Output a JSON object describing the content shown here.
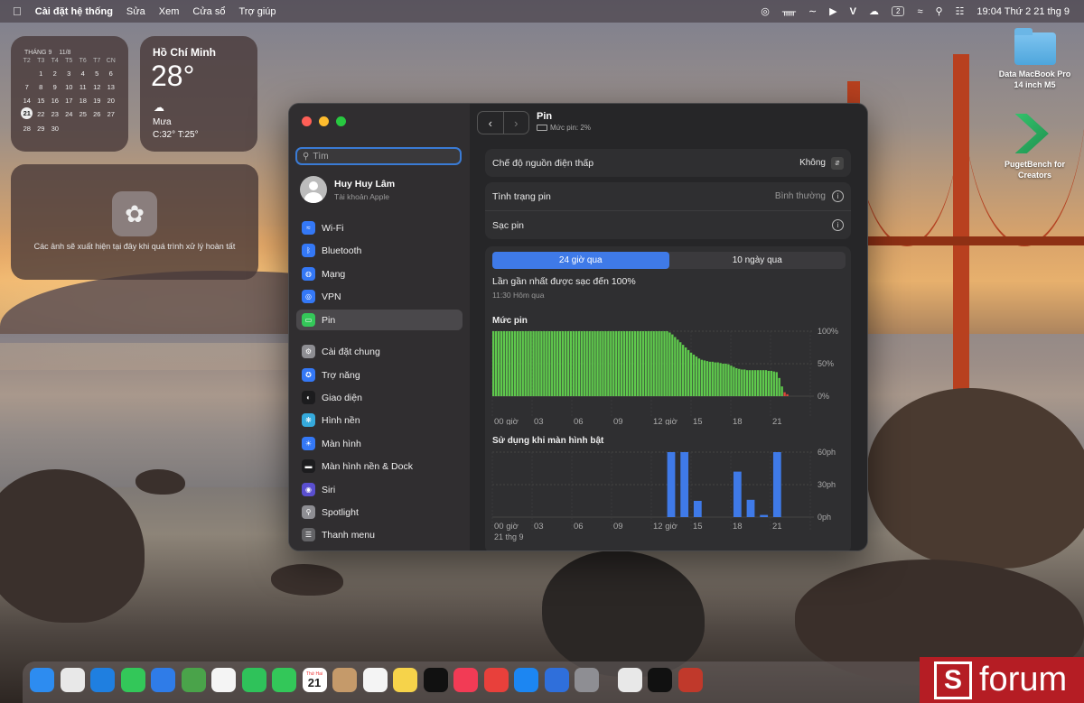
{
  "menubar": {
    "apple_icon": "apple-logo-icon",
    "app_name": "Cài đặt hệ thống",
    "menus": [
      "Sửa",
      "Xem",
      "Cửa sổ",
      "Trợ giúp"
    ],
    "battery_badge": "2",
    "clock": "19:04 Thứ 2 21 thg 9"
  },
  "calendar_widget": {
    "month": "THÁNG 9",
    "lunar": "11/8",
    "weekdays": [
      "T2",
      "T3",
      "T4",
      "T5",
      "T6",
      "T7",
      "CN"
    ],
    "days": [
      "",
      "1",
      "2",
      "3",
      "4",
      "5",
      "6",
      "7",
      "8",
      "9",
      "10",
      "11",
      "12",
      "13",
      "14",
      "15",
      "16",
      "17",
      "18",
      "19",
      "20",
      "21",
      "22",
      "23",
      "24",
      "25",
      "26",
      "27",
      "28",
      "29",
      "30",
      "",
      "",
      "",
      "",
      ""
    ],
    "today": "21"
  },
  "weather_widget": {
    "city": "Hồ Chí Minh",
    "temp": "28°",
    "condition": "Mưa",
    "high_low": "C:32° T:25°"
  },
  "photos_widget": {
    "message": "Các ảnh sẽ xuất hiện tại đây khi quá trình xử lý hoàn tất"
  },
  "desktop_icons": [
    {
      "label_line1": "Data MacBook Pro",
      "label_line2": "14 inch M5"
    },
    {
      "label_line1": "PugetBench for",
      "label_line2": "Creators"
    }
  ],
  "sidebar": {
    "search_placeholder": "Tìm",
    "user_name": "Huy Huy Lâm",
    "user_sub": "Tài khoản Apple",
    "items": [
      {
        "label": "Wi-Fi",
        "icon": "wifi-icon",
        "color": "#3478f6"
      },
      {
        "label": "Bluetooth",
        "icon": "bluetooth-icon",
        "color": "#3478f6"
      },
      {
        "label": "Mạng",
        "icon": "globe-icon",
        "color": "#3478f6"
      },
      {
        "label": "VPN",
        "icon": "vpn-icon",
        "color": "#3478f6"
      },
      {
        "label": "Pin",
        "icon": "battery-icon",
        "color": "#34c759"
      },
      {
        "label": "Cài đặt chung",
        "icon": "gear-icon",
        "color": "#8e8e93"
      },
      {
        "label": "Trợ năng",
        "icon": "accessibility-icon",
        "color": "#3478f6"
      },
      {
        "label": "Giao diện",
        "icon": "appearance-icon",
        "color": "#1c1c1e"
      },
      {
        "label": "Hình nền",
        "icon": "wallpaper-icon",
        "color": "#35aadc"
      },
      {
        "label": "Màn hình",
        "icon": "display-icon",
        "color": "#3478f6"
      },
      {
        "label": "Màn hình nền & Dock",
        "icon": "dock-icon",
        "color": "#1c1c1e"
      },
      {
        "label": "Siri",
        "icon": "siri-icon",
        "color": "#5a4fcf"
      },
      {
        "label": "Spotlight",
        "icon": "spotlight-icon",
        "color": "#8e8e93"
      },
      {
        "label": "Thanh menu",
        "icon": "menubar-icon",
        "color": "#636366"
      }
    ]
  },
  "main": {
    "title": "Pin",
    "subtitle": "Mức pin: 2%",
    "low_power_label": "Chế độ nguồn điện thấp",
    "low_power_value": "Không",
    "health_label": "Tình trạng pin",
    "health_value": "Bình thường",
    "charging_label": "Sạc pin",
    "tabs": [
      "24 giờ qua",
      "10 ngày qua"
    ],
    "last_charged": "Lần gần nhất được sạc đến 100%",
    "last_charged_time": "11:30 Hôm qua",
    "date_label": "21 thg 9"
  },
  "chart_data": [
    {
      "type": "bar",
      "title": "Mức pin",
      "ylabel": "",
      "x_tick_labels": [
        "00 giờ",
        "03",
        "06",
        "09",
        "12 giờ",
        "15",
        "18",
        "21"
      ],
      "y_tick_labels": [
        "100%",
        "50%",
        "0%"
      ],
      "ylim": [
        0,
        100
      ],
      "bar_color": "#5fc94d",
      "low_color": "#e0453a",
      "values": [
        100,
        100,
        100,
        100,
        100,
        100,
        100,
        100,
        100,
        100,
        100,
        100,
        100,
        100,
        100,
        100,
        100,
        100,
        100,
        100,
        100,
        100,
        100,
        100,
        100,
        100,
        100,
        100,
        100,
        100,
        100,
        100,
        100,
        100,
        100,
        100,
        100,
        100,
        100,
        100,
        100,
        100,
        100,
        100,
        100,
        100,
        100,
        100,
        100,
        100,
        100,
        100,
        100,
        100,
        100,
        100,
        100,
        100,
        100,
        100,
        100,
        100,
        100,
        100,
        100,
        100,
        98,
        95,
        91,
        87,
        83,
        79,
        75,
        71,
        67,
        64,
        61,
        58,
        56,
        55,
        54,
        53,
        53,
        52,
        52,
        51,
        50,
        50,
        49,
        47,
        45,
        43,
        42,
        41,
        41,
        40,
        40,
        40,
        40,
        40,
        40,
        40,
        40,
        39,
        39,
        38,
        37,
        28,
        15,
        6,
        3
      ]
    },
    {
      "type": "bar",
      "title": "Sử dụng khi màn hình bật",
      "ylabel": "",
      "x_tick_labels": [
        "00 giờ",
        "03",
        "06",
        "09",
        "12 giờ",
        "15",
        "18",
        "21"
      ],
      "y_tick_labels": [
        "60ph",
        "30ph",
        "0ph"
      ],
      "ylim": [
        0,
        60
      ],
      "bar_color": "#3f7ae8",
      "hours": [
        0,
        1,
        2,
        3,
        4,
        5,
        6,
        7,
        8,
        9,
        10,
        11,
        12,
        13,
        14,
        15,
        16,
        17,
        18,
        19,
        20,
        21,
        22,
        23
      ],
      "values": [
        0,
        0,
        0,
        0,
        0,
        0,
        0,
        0,
        0,
        0,
        0,
        0,
        0,
        60,
        60,
        15,
        0,
        0,
        42,
        16,
        2,
        60,
        0,
        0
      ]
    }
  ],
  "dock_apps": [
    "Finder",
    "Launchpad",
    "Safari",
    "Tin nhắn",
    "Mail",
    "Bản đồ",
    "Ảnh",
    "FaceTime",
    "Điện thoại",
    "Lịch",
    "Danh bạ",
    "Lời nhắc",
    "Ghi chú",
    "TV",
    "Nhạc",
    "Rocket",
    "App Store",
    "Simulator",
    "Cài đặt hệ thống",
    "Creative Cloud",
    "CapCut",
    "Photo Booth"
  ],
  "dock_calendar": {
    "weekday": "Thứ Hai",
    "day": "21"
  },
  "watermark": "forum"
}
